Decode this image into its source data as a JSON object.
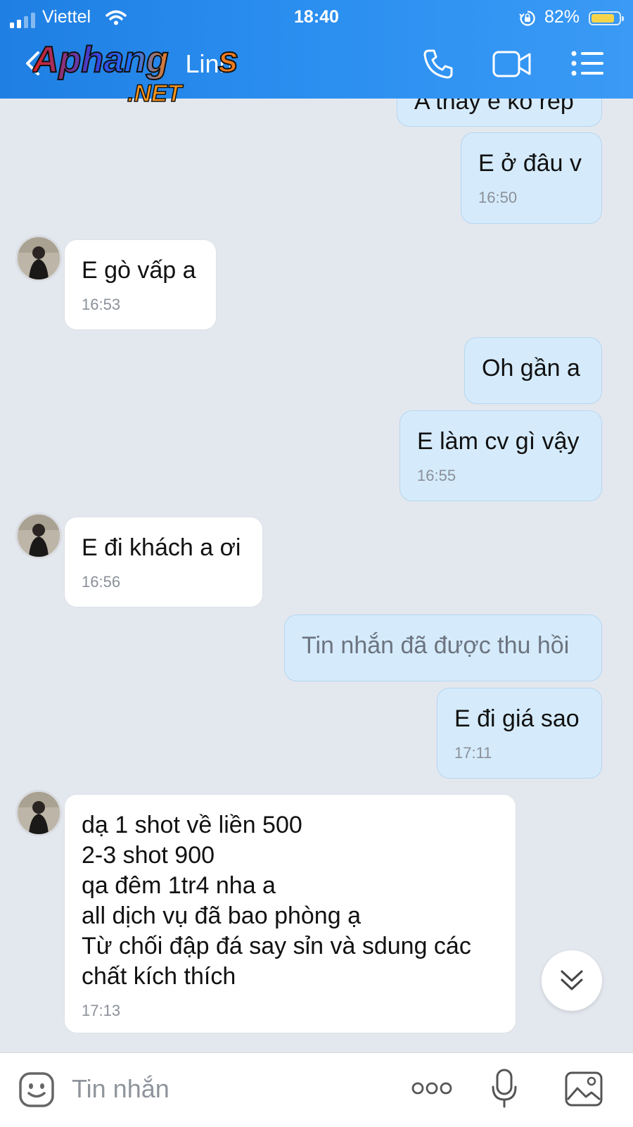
{
  "status_bar": {
    "carrier": "Viettel",
    "time": "18:40",
    "battery_percent": "82%",
    "battery_level": 0.82
  },
  "header": {
    "contact_name": "Linh",
    "watermark_text": "Aphang",
    "watermark_suffix": ".NET"
  },
  "messages": [
    {
      "direction": "out",
      "text": "A thấy e ko rep",
      "time": ""
    },
    {
      "direction": "out",
      "text": "E ở đâu v",
      "time": "16:50"
    },
    {
      "direction": "in",
      "text": "E gò vấp a",
      "time": "16:53"
    },
    {
      "direction": "out",
      "text": "Oh gần a",
      "time": ""
    },
    {
      "direction": "out",
      "text": "E làm cv gì vậy",
      "time": "16:55"
    },
    {
      "direction": "in",
      "text": "E đi khách a ơi",
      "time": "16:56"
    },
    {
      "direction": "out",
      "text": "Tin nhắn đã được thu hồi",
      "time": "",
      "recalled": true
    },
    {
      "direction": "out",
      "text": "E đi giá sao",
      "time": "17:11"
    },
    {
      "direction": "in",
      "lines": [
        "dạ 1 shot về liền 500",
        "2-3 shot 900",
        "qa đêm 1tr4 nha a",
        "all dịch vụ đã bao phòng ạ",
        "Từ chối đập đá say sỉn và sdung các",
        "chất kích thích"
      ],
      "time": "17:13"
    }
  ],
  "input_bar": {
    "placeholder": "Tin nhắn"
  },
  "icons": {
    "back": "chevron-left-icon",
    "call": "phone-icon",
    "video": "video-camera-icon",
    "menu": "list-menu-icon",
    "sticker": "sticker-smile-icon",
    "more": "more-dots-icon",
    "mic": "microphone-icon",
    "gallery": "image-gallery-icon",
    "scroll_down": "double-chevron-down-icon"
  },
  "colors": {
    "header": "#2b8ff0",
    "outgoing_bubble": "#d5ebfb",
    "incoming_bubble": "#ffffff",
    "chat_background": "#e3e7ee"
  }
}
